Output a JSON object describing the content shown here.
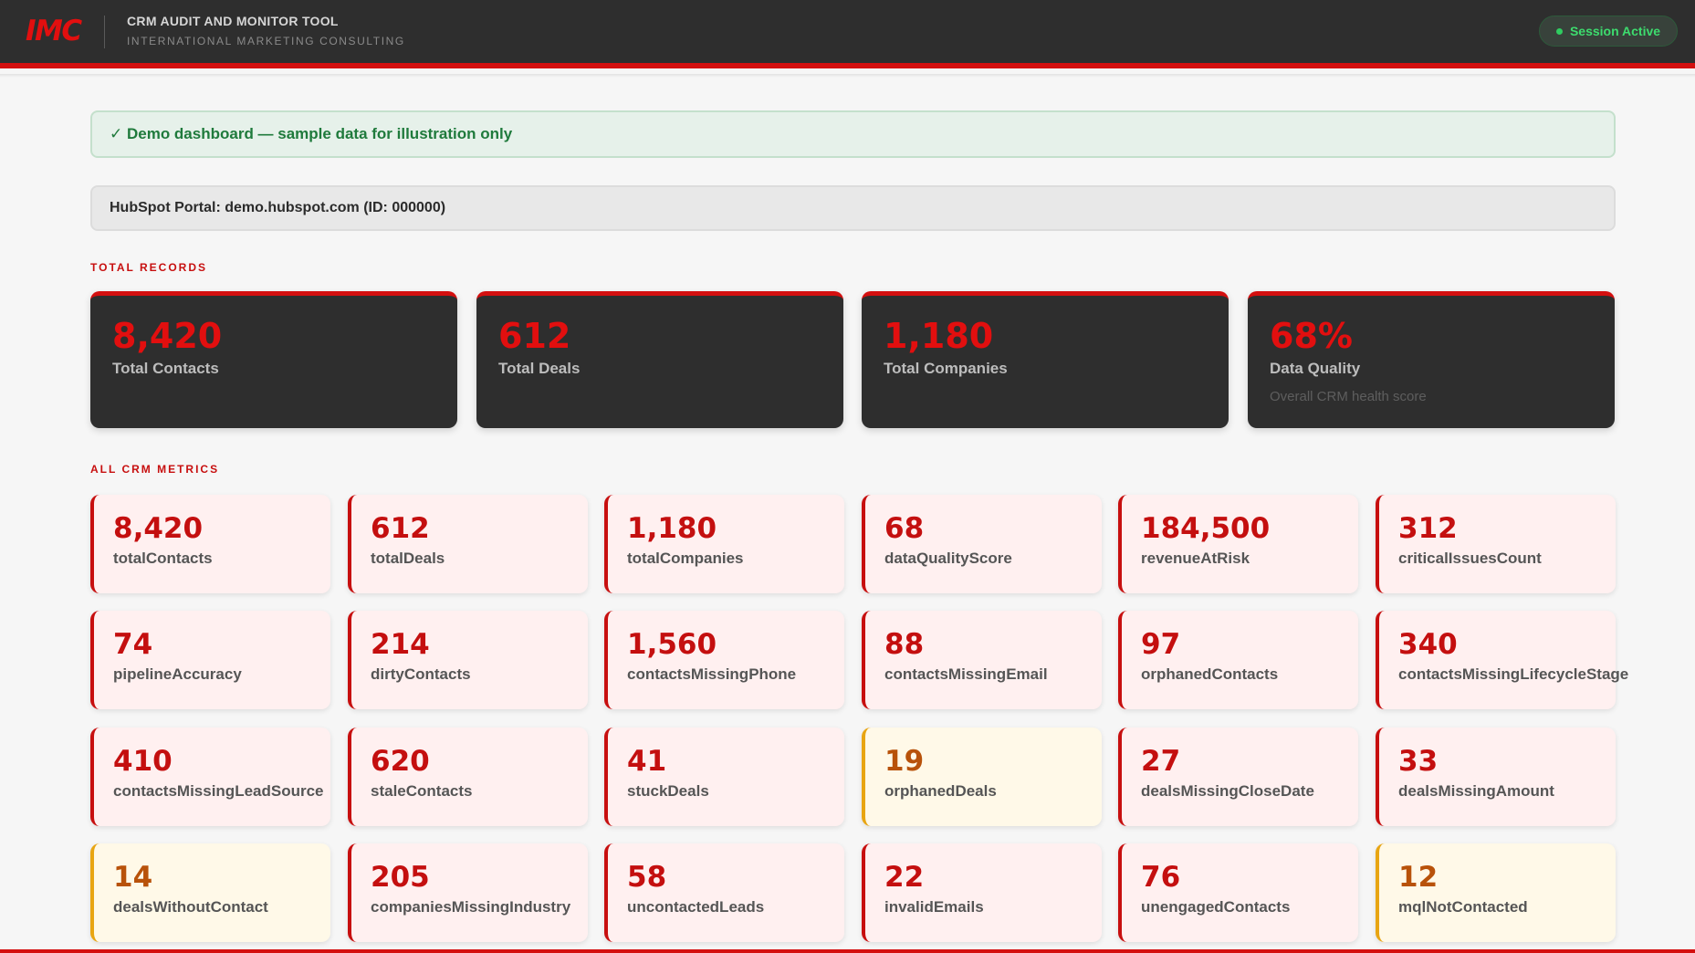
{
  "header": {
    "logo": "IMC",
    "title": "CRM AUDIT AND MONITOR TOOL",
    "subtitle": "INTERNATIONAL MARKETING CONSULTING",
    "session": "Session Active",
    "colors": {
      "accent": "#d40f0f",
      "bar": "#2e2e2e",
      "session": "#3ddc6e"
    }
  },
  "notice": "✓ Demo dashboard — sample data for illustration only",
  "portal": {
    "label": "HubSpot Portal: ",
    "domain": "demo.hubspot.com",
    "id": " (ID: 000000)"
  },
  "sections": {
    "total": "TOTAL RECORDS",
    "metrics": "ALL CRM METRICS"
  },
  "summary": [
    {
      "value": "8,420",
      "label": "Total Contacts",
      "sub": ""
    },
    {
      "value": "612",
      "label": "Total Deals",
      "sub": ""
    },
    {
      "value": "1,180",
      "label": "Total Companies",
      "sub": ""
    },
    {
      "value": "68%",
      "label": "Data Quality",
      "sub": "Overall CRM health score"
    }
  ],
  "metrics": [
    {
      "value": "8,420",
      "label": "totalContacts",
      "status": "critical"
    },
    {
      "value": "612",
      "label": "totalDeals",
      "status": "critical"
    },
    {
      "value": "1,180",
      "label": "totalCompanies",
      "status": "critical"
    },
    {
      "value": "68",
      "label": "dataQualityScore",
      "status": "critical"
    },
    {
      "value": "184,500",
      "label": "revenueAtRisk",
      "status": "critical"
    },
    {
      "value": "312",
      "label": "criticalIssuesCount",
      "status": "critical"
    },
    {
      "value": "74",
      "label": "pipelineAccuracy",
      "status": "critical"
    },
    {
      "value": "214",
      "label": "dirtyContacts",
      "status": "critical"
    },
    {
      "value": "1,560",
      "label": "contactsMissingPhone",
      "status": "critical"
    },
    {
      "value": "88",
      "label": "contactsMissingEmail",
      "status": "critical"
    },
    {
      "value": "97",
      "label": "orphanedContacts",
      "status": "critical"
    },
    {
      "value": "340",
      "label": "contactsMissingLifecycleStage",
      "status": "critical"
    },
    {
      "value": "410",
      "label": "contactsMissingLeadSource",
      "status": "critical"
    },
    {
      "value": "620",
      "label": "staleContacts",
      "status": "critical"
    },
    {
      "value": "41",
      "label": "stuckDeals",
      "status": "critical"
    },
    {
      "value": "19",
      "label": "orphanedDeals",
      "status": "warning"
    },
    {
      "value": "27",
      "label": "dealsMissingCloseDate",
      "status": "critical"
    },
    {
      "value": "33",
      "label": "dealsMissingAmount",
      "status": "critical"
    },
    {
      "value": "14",
      "label": "dealsWithoutContact",
      "status": "warning"
    },
    {
      "value": "205",
      "label": "companiesMissingIndustry",
      "status": "critical"
    },
    {
      "value": "58",
      "label": "uncontactedLeads",
      "status": "critical"
    },
    {
      "value": "22",
      "label": "invalidEmails",
      "status": "critical"
    },
    {
      "value": "76",
      "label": "unengagedContacts",
      "status": "critical"
    },
    {
      "value": "12",
      "label": "mqlNotContacted",
      "status": "warning"
    }
  ]
}
